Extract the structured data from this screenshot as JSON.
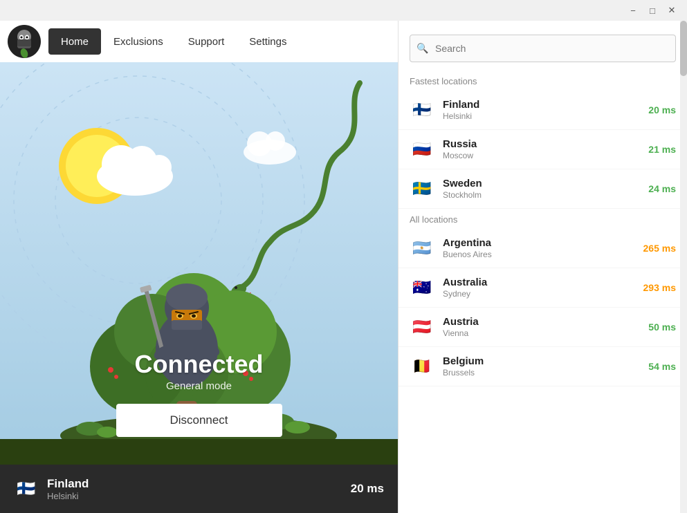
{
  "titleBar": {
    "minimize": "−",
    "maximize": "□",
    "close": "✕"
  },
  "nav": {
    "logo_alt": "VPN Ninja Logo",
    "items": [
      {
        "label": "Home",
        "active": true
      },
      {
        "label": "Exclusions",
        "active": false
      },
      {
        "label": "Support",
        "active": false
      },
      {
        "label": "Settings",
        "active": false
      }
    ]
  },
  "status": {
    "connected": "Connected",
    "mode": "General mode",
    "disconnect_label": "Disconnect"
  },
  "bottomBar": {
    "country": "Finland",
    "city": "Helsinki",
    "ping": "20 ms"
  },
  "search": {
    "placeholder": "Search"
  },
  "fastestLocations": {
    "header": "Fastest locations",
    "items": [
      {
        "country": "Finland",
        "city": "Helsinki",
        "ping": "20 ms",
        "ping_type": "green",
        "flag": "🇫🇮"
      },
      {
        "country": "Russia",
        "city": "Moscow",
        "ping": "21 ms",
        "ping_type": "green",
        "flag": "🇷🇺"
      },
      {
        "country": "Sweden",
        "city": "Stockholm",
        "ping": "24 ms",
        "ping_type": "green",
        "flag": "🇸🇪"
      }
    ]
  },
  "allLocations": {
    "header": "All locations",
    "items": [
      {
        "country": "Argentina",
        "city": "Buenos Aires",
        "ping": "265 ms",
        "ping_type": "orange",
        "flag": "🇦🇷"
      },
      {
        "country": "Australia",
        "city": "Sydney",
        "ping": "293 ms",
        "ping_type": "orange",
        "flag": "🇦🇺"
      },
      {
        "country": "Austria",
        "city": "Vienna",
        "ping": "50 ms",
        "ping_type": "green",
        "flag": "🇦🇹"
      },
      {
        "country": "Belgium",
        "city": "Brussels",
        "ping": "54 ms",
        "ping_type": "green",
        "flag": "🇧🇪"
      }
    ]
  }
}
